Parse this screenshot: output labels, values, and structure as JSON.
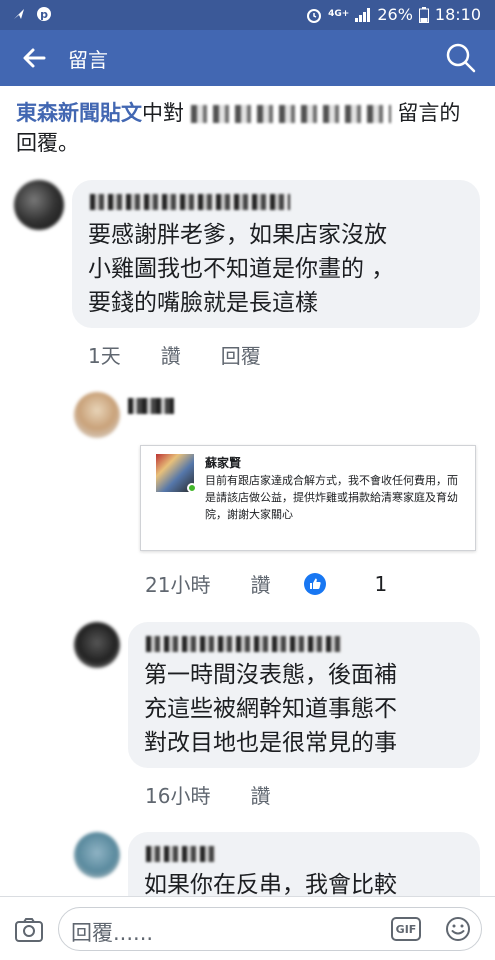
{
  "status_bar": {
    "network": "4G+",
    "battery": "26%",
    "time": "18:10"
  },
  "header": {
    "title": "留言"
  },
  "context": {
    "page_name": "東森新聞貼文",
    "prefix": "中對",
    "suffix": "留言的回覆。"
  },
  "comments": [
    {
      "text": "要感謝胖老爹，如果店家沒放\n小雞圖我也不知道是你畫的 ，\n要錢的嘴臉就是長這樣",
      "time": "1天",
      "like_label": "讚",
      "reply_label": "回覆"
    },
    {
      "shared_card": {
        "name": "蘇家賢",
        "body": "目前有跟店家達成合解方式，我不會收任何費用，而是請該店做公益，提供炸雞或捐款給清寒家庭及育幼院，謝謝大家關心"
      },
      "time": "21小時",
      "like_label": "讚",
      "like_count": "1"
    },
    {
      "text": "第一時間沒表態，後面補\n充這些被網幹知道事態不\n對改目地也是很常見的事",
      "time": "16小時",
      "like_label": "讚"
    },
    {
      "text": "如果你在反串，我會比較"
    }
  ],
  "composer": {
    "placeholder": "回覆......",
    "gif_label": "GIF"
  }
}
